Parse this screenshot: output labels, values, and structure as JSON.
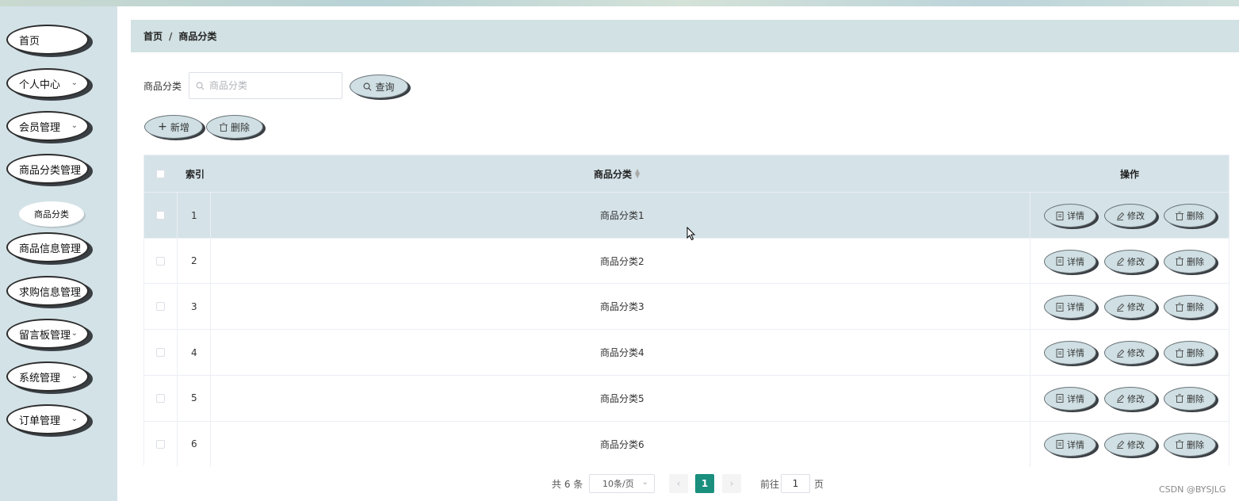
{
  "sidebar": {
    "items": [
      {
        "label": "首页",
        "has_chevron": false
      },
      {
        "label": "个人中心",
        "has_chevron": true
      },
      {
        "label": "会员管理",
        "has_chevron": true
      },
      {
        "label": "商品分类管理",
        "has_chevron": false
      },
      {
        "label": "商品信息管理",
        "has_chevron": false
      },
      {
        "label": "求购信息管理",
        "has_chevron": false
      },
      {
        "label": "留言板管理",
        "has_chevron": true
      },
      {
        "label": "系统管理",
        "has_chevron": true
      },
      {
        "label": "订单管理",
        "has_chevron": true
      }
    ],
    "subitem": "商品分类"
  },
  "breadcrumb": {
    "home": "首页",
    "separator": "/",
    "current": "商品分类"
  },
  "search": {
    "label": "商品分类",
    "placeholder": "商品分类",
    "value": "",
    "button": "查询"
  },
  "toolbar": {
    "add": "新增",
    "delete": "删除"
  },
  "table": {
    "headers": {
      "index": "索引",
      "category": "商品分类",
      "actions": "操作"
    },
    "rows": [
      {
        "index": "1",
        "category": "商品分类1"
      },
      {
        "index": "2",
        "category": "商品分类2"
      },
      {
        "index": "3",
        "category": "商品分类3"
      },
      {
        "index": "4",
        "category": "商品分类4"
      },
      {
        "index": "5",
        "category": "商品分类5"
      },
      {
        "index": "6",
        "category": "商品分类6"
      }
    ],
    "actions": {
      "detail": "详情",
      "edit": "修改",
      "delete": "删除"
    }
  },
  "pagination": {
    "total": "共 6 条",
    "page_size": "10条/页",
    "current": "1",
    "goto_label": "前往",
    "goto_value": "1",
    "page_suffix": "页"
  },
  "watermark": "CSDN @BYSJLG",
  "colors": {
    "sidebar_bg": "#d3e2e7",
    "header_bg": "#d5e3e8",
    "accent": "#1a8f7e",
    "button_bg": "#cfdfe3"
  },
  "icons": {
    "search": "search-icon",
    "add": "plus-icon",
    "delete": "trash-icon",
    "detail": "document-icon",
    "edit": "pencil-icon",
    "chevron": "chevron-down-icon"
  }
}
